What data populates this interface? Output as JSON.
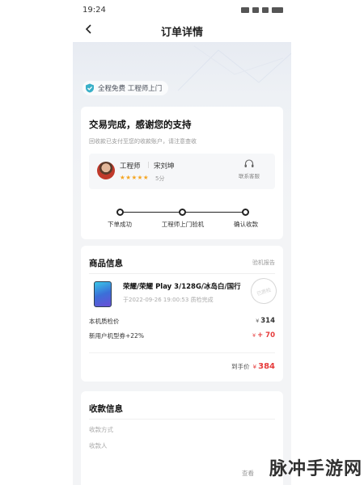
{
  "status_bar": {
    "time": "19:24"
  },
  "header": {
    "title": "订单详情"
  },
  "guarantee": {
    "text": "全程免费 工程师上门"
  },
  "status_card": {
    "title": "交易完成，感谢您的支持",
    "subtitle": "回收款已支付至您的收款账户，请注意查收",
    "engineer": {
      "role": "工程师",
      "name": "宋刘坤",
      "stars": "★★★★★",
      "score": "5分"
    },
    "contact_label": "联系客服",
    "steps": [
      "下单成功",
      "工程师上门验机",
      "确认收款"
    ]
  },
  "goods": {
    "section_title": "商品信息",
    "report_link": "验机报告",
    "product_name": "荣耀/荣耀 Play 3/128G/冰岛白/国行",
    "inspect_time": "于2022-09-26 19:00:53 质检完成",
    "stamp": "已质检",
    "currency": "¥",
    "rows": [
      {
        "label": "本机质检价",
        "value": "314"
      },
      {
        "label": "新用户机型券+22%",
        "value": "+ 70"
      }
    ],
    "final_label": "到手价",
    "final_value": "384"
  },
  "payment": {
    "section_title": "收款信息",
    "rows": [
      "收款方式",
      "收款人"
    ],
    "review_link": "查看"
  },
  "watermark": "脉冲手游网",
  "colors": {
    "accent_red": "#e63b3b",
    "star": "#f5a623"
  }
}
